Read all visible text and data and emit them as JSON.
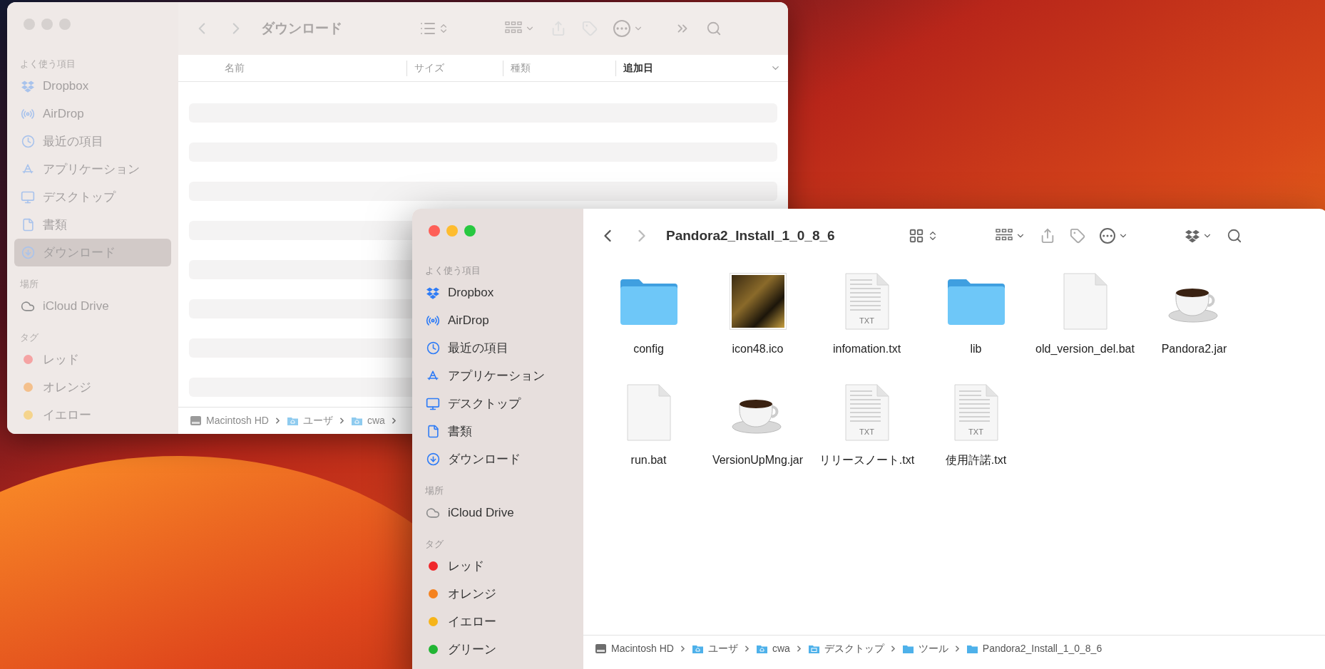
{
  "back_window": {
    "active": false,
    "title": "ダウンロード",
    "sidebar": [
      {
        "heading": "よく使う項目",
        "items": [
          {
            "label": "Dropbox",
            "kind": "dropbox",
            "selected": false
          },
          {
            "label": "AirDrop",
            "kind": "airdrop",
            "selected": false
          },
          {
            "label": "最近の項目",
            "kind": "recent",
            "selected": false
          },
          {
            "label": "アプリケーション",
            "kind": "apps",
            "selected": false
          },
          {
            "label": "デスクトップ",
            "kind": "desktop",
            "selected": false
          },
          {
            "label": "書類",
            "kind": "documents",
            "selected": false
          },
          {
            "label": "ダウンロード",
            "kind": "downloads",
            "selected": true
          }
        ]
      },
      {
        "heading": "場所",
        "items": [
          {
            "label": "iCloud Drive",
            "kind": "cloud",
            "selected": false
          }
        ]
      },
      {
        "heading": "タグ",
        "items": [
          {
            "label": "レッド",
            "kind": "tag",
            "color": "#f5a3a3",
            "selected": false
          },
          {
            "label": "オレンジ",
            "kind": "tag",
            "color": "#f4c08c",
            "selected": false
          },
          {
            "label": "イエロー",
            "kind": "tag",
            "color": "#f5d48c",
            "selected": false
          }
        ]
      }
    ],
    "columns": [
      {
        "label": "名前",
        "selected": false
      },
      {
        "label": "サイズ",
        "selected": false
      },
      {
        "label": "種類",
        "selected": false
      },
      {
        "label": "追加日",
        "selected": true
      }
    ],
    "path": [
      {
        "label": "Macintosh HD",
        "kind": "disk"
      },
      {
        "label": "ユーザ",
        "kind": "home"
      },
      {
        "label": "cwa",
        "kind": "home"
      }
    ]
  },
  "front_window": {
    "active": true,
    "title": "Pandora2_Install_1_0_8_6",
    "sidebar": [
      {
        "heading": "よく使う項目",
        "items": [
          {
            "label": "Dropbox",
            "kind": "dropbox",
            "selected": false
          },
          {
            "label": "AirDrop",
            "kind": "airdrop",
            "selected": false
          },
          {
            "label": "最近の項目",
            "kind": "recent",
            "selected": false
          },
          {
            "label": "アプリケーション",
            "kind": "apps",
            "selected": false
          },
          {
            "label": "デスクトップ",
            "kind": "desktop",
            "selected": false
          },
          {
            "label": "書類",
            "kind": "documents",
            "selected": false
          },
          {
            "label": "ダウンロード",
            "kind": "downloads",
            "selected": false
          }
        ]
      },
      {
        "heading": "場所",
        "items": [
          {
            "label": "iCloud Drive",
            "kind": "cloud",
            "selected": false
          }
        ]
      },
      {
        "heading": "タグ",
        "items": [
          {
            "label": "レッド",
            "kind": "tag",
            "color": "#f0272b",
            "selected": false
          },
          {
            "label": "オレンジ",
            "kind": "tag",
            "color": "#f5821f",
            "selected": false
          },
          {
            "label": "イエロー",
            "kind": "tag",
            "color": "#f6b419",
            "selected": false
          },
          {
            "label": "グリーン",
            "kind": "tag",
            "color": "#22b534",
            "selected": false
          }
        ]
      }
    ],
    "files": [
      {
        "name": "config",
        "kind": "folder"
      },
      {
        "name": "icon48.ico",
        "kind": "image"
      },
      {
        "name": "infomation.txt",
        "kind": "text",
        "icon_label": "TXT"
      },
      {
        "name": "lib",
        "kind": "folder"
      },
      {
        "name": "old_version_del.bat",
        "kind": "blank"
      },
      {
        "name": "Pandora2.jar",
        "kind": "jar"
      },
      {
        "name": "run.bat",
        "kind": "blank"
      },
      {
        "name": "VersionUpMng.jar",
        "kind": "jar"
      },
      {
        "name": "リリースノート.txt",
        "kind": "text",
        "icon_label": "TXT"
      },
      {
        "name": "使用許諾.txt",
        "kind": "text",
        "icon_label": "TXT"
      }
    ],
    "path": [
      {
        "label": "Macintosh HD",
        "kind": "disk"
      },
      {
        "label": "ユーザ",
        "kind": "home"
      },
      {
        "label": "cwa",
        "kind": "home"
      },
      {
        "label": "デスクトップ",
        "kind": "desktop"
      },
      {
        "label": "ツール",
        "kind": "folder"
      },
      {
        "label": "Pandora2_Install_1_0_8_6",
        "kind": "folder"
      }
    ]
  }
}
